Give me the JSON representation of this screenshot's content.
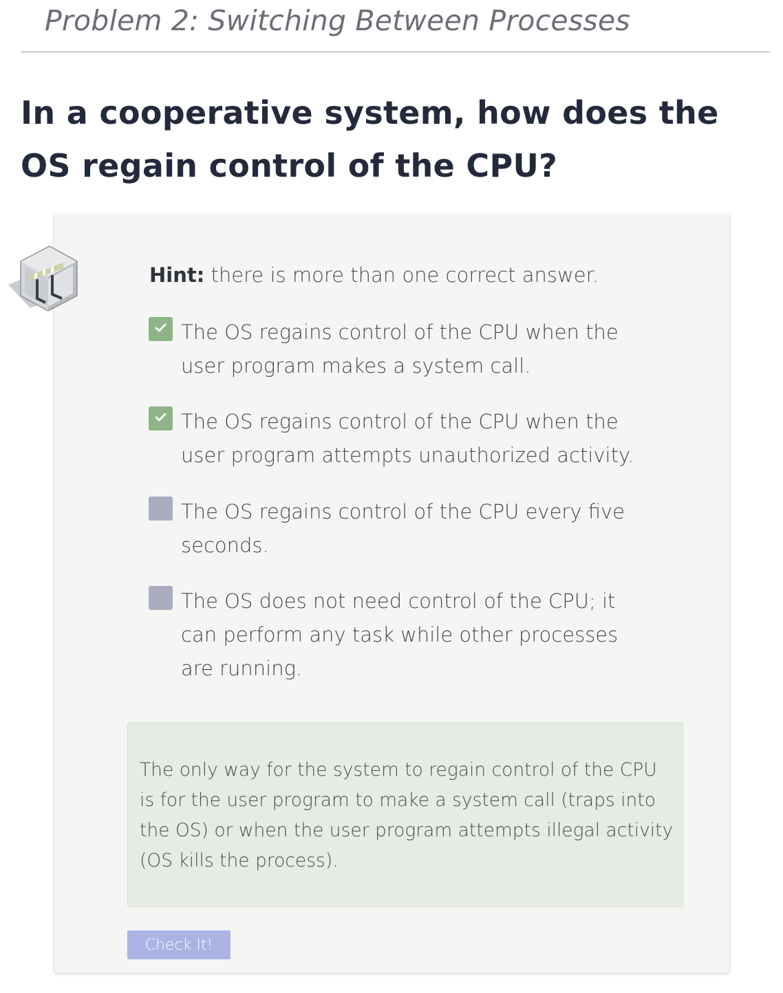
{
  "page": {
    "subtitle": "Problem 2: Switching Between Processes",
    "question": "In a cooperative system, how does the OS regain control of the CPU?"
  },
  "quiz": {
    "icon": "process-switch-illustration-icon",
    "hint_label": "Hint:",
    "hint_text": " there is more than one correct answer.",
    "options": [
      {
        "text": "The OS regains control of the CPU when the user program makes a system call.",
        "checked": true
      },
      {
        "text": "The OS regains control of the CPU when the user program attempts unauthorized activity.",
        "checked": true
      },
      {
        "text": "The OS regains control of the CPU every five seconds.",
        "checked": false
      },
      {
        "text": "The OS does not need control of the CPU; it can perform any task while other processes are running.",
        "checked": false
      }
    ],
    "explanation": "The only way for the system to regain control of the CPU is for the user program to make a system call (traps into the OS) or when the user program attempts illegal activity (OS kills the process).",
    "check_button_label": "Check It!"
  },
  "colors": {
    "checked_box": "#8fb488",
    "unchecked_box": "#abacbf",
    "explanation_bg": "#e5ece3",
    "button_bg": "#aab4e3"
  }
}
